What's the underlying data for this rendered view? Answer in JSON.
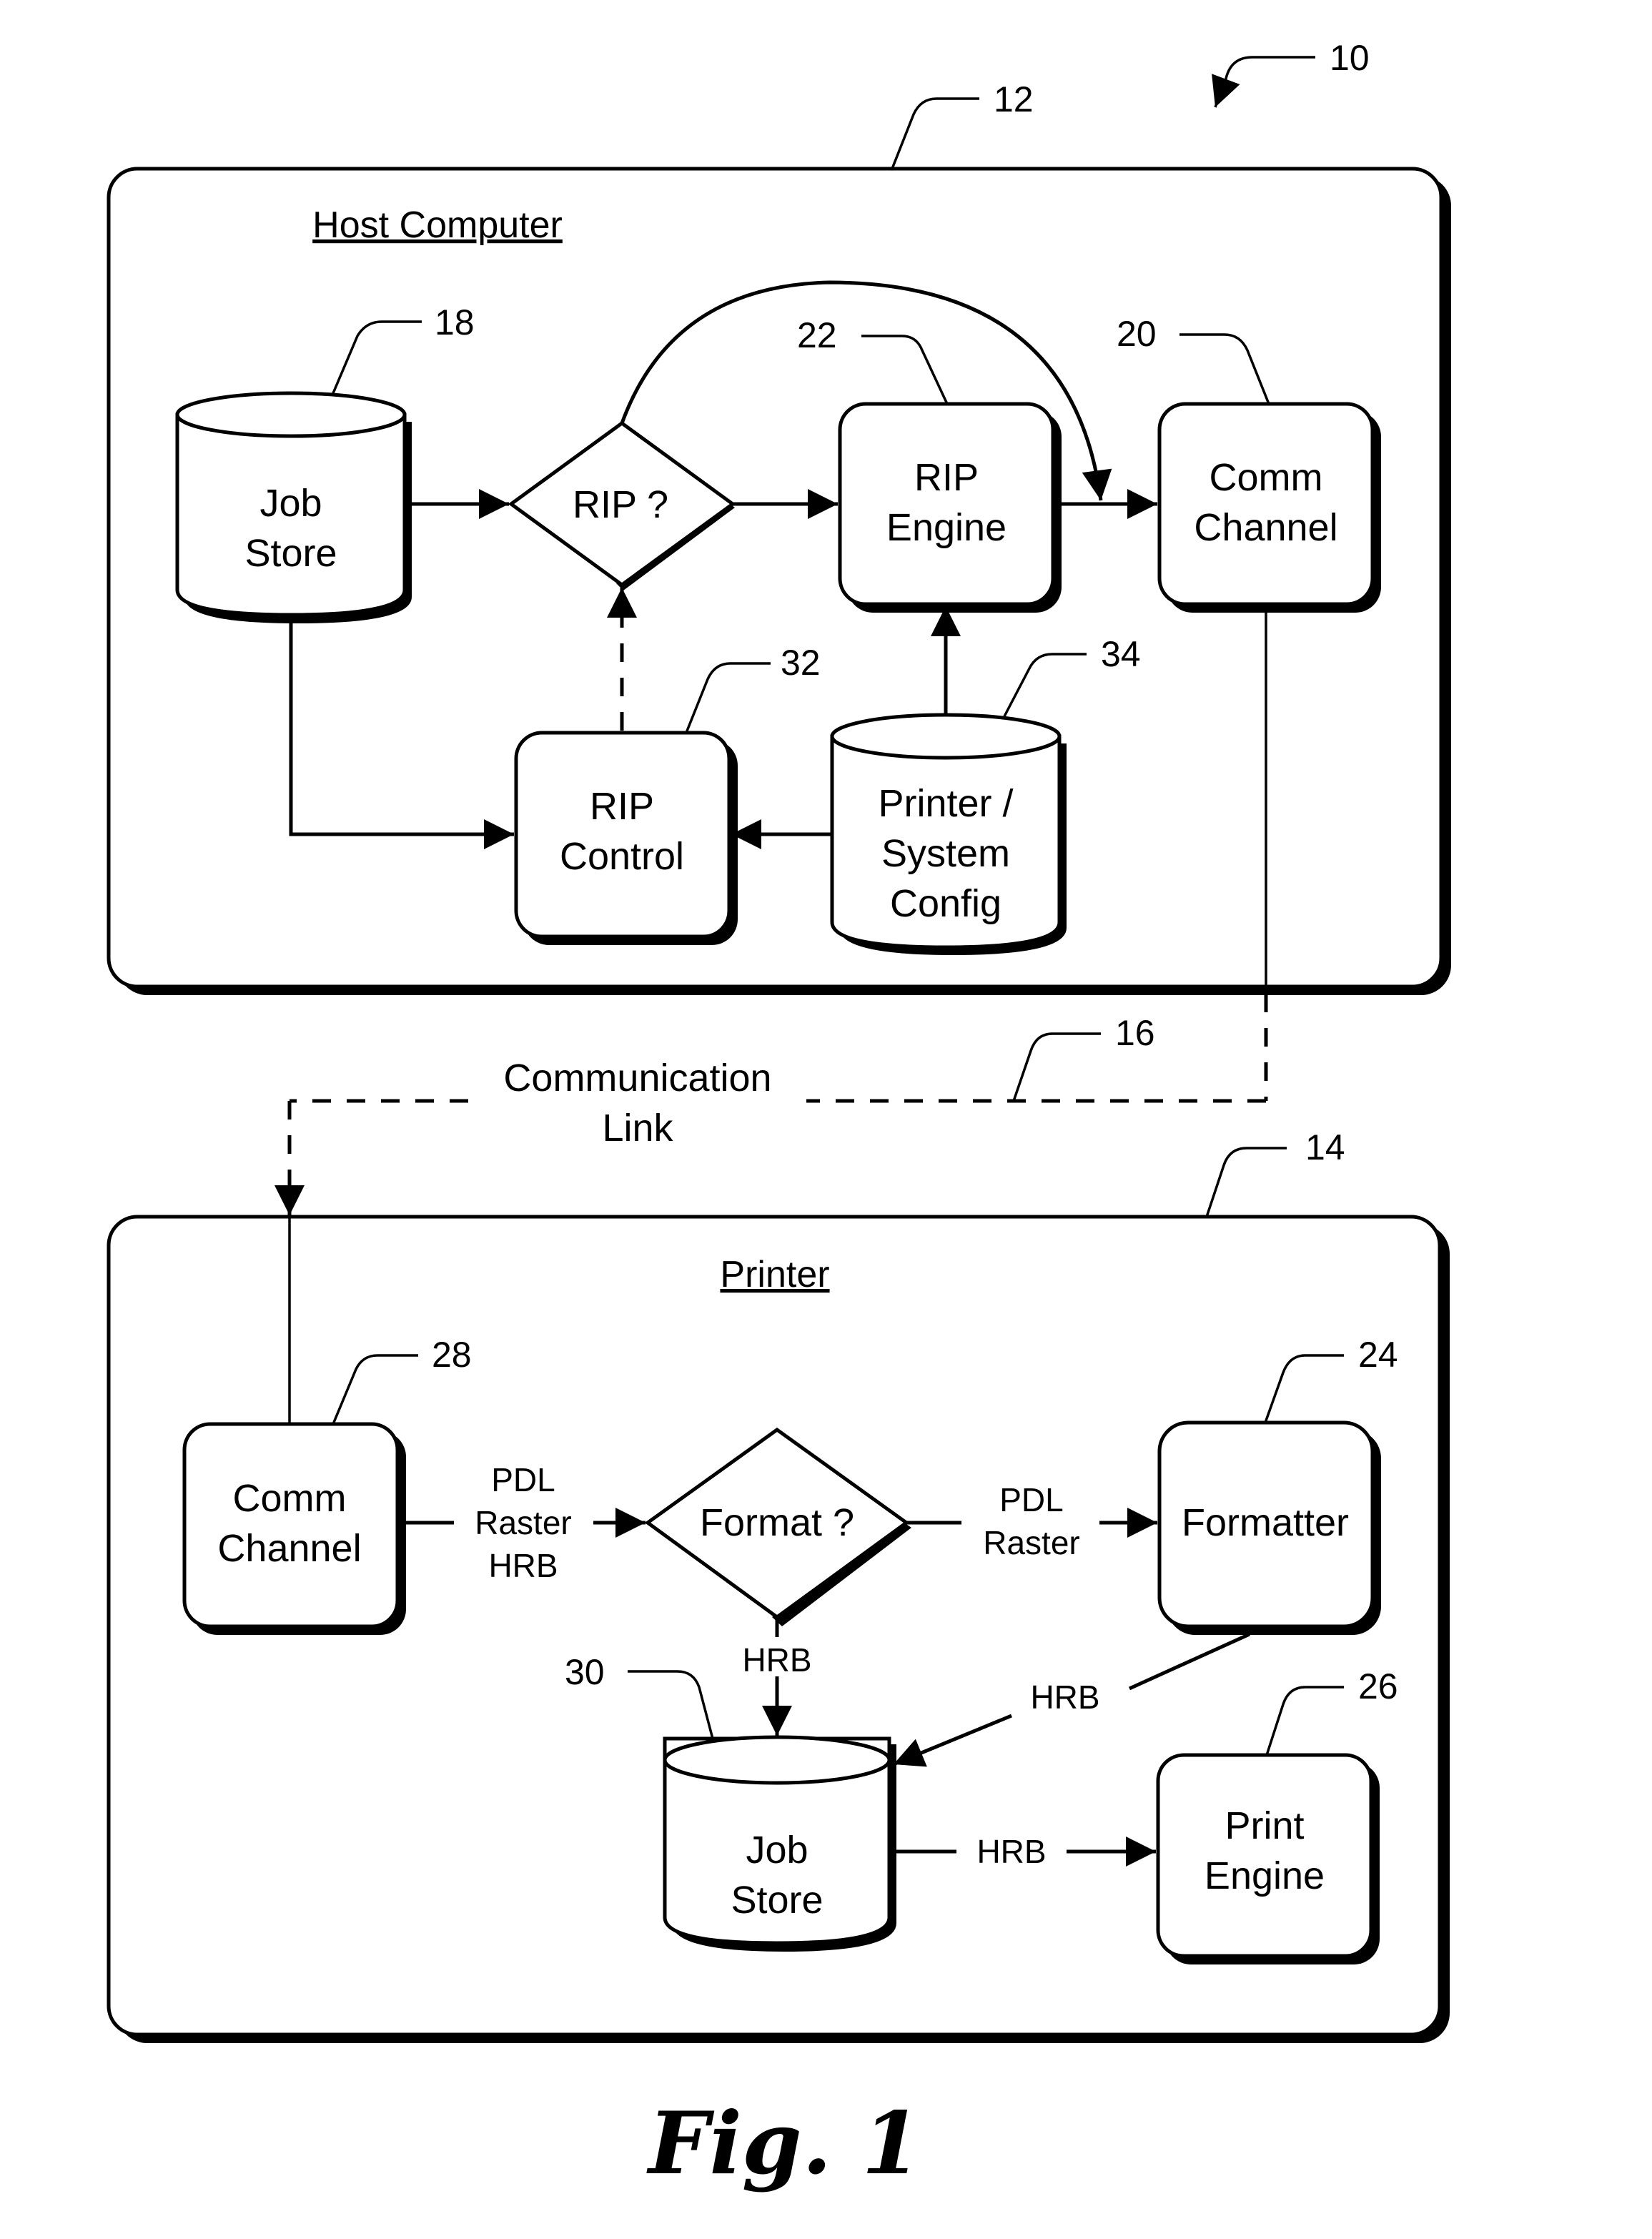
{
  "figure": {
    "caption": "Fig. 1",
    "system_ref": "10"
  },
  "containers": {
    "host": {
      "title": "Host Computer",
      "ref": "12"
    },
    "printer": {
      "title": "Printer",
      "ref": "14"
    }
  },
  "link": {
    "label_line1": "Communication",
    "label_line2": "Link",
    "ref": "16"
  },
  "host_nodes": {
    "job_store": {
      "lines": [
        "Job",
        "Store"
      ],
      "ref": "18",
      "shape": "cylinder"
    },
    "rip_decision": {
      "lines": [
        "RIP ?"
      ],
      "shape": "diamond"
    },
    "rip_engine": {
      "lines": [
        "RIP",
        "Engine"
      ],
      "ref": "22",
      "shape": "rounded-box"
    },
    "comm_channel": {
      "lines": [
        "Comm",
        "Channel"
      ],
      "ref": "20",
      "shape": "rounded-box"
    },
    "rip_control": {
      "lines": [
        "RIP",
        "Control"
      ],
      "ref": "32",
      "shape": "rounded-box"
    },
    "config": {
      "lines": [
        "Printer /",
        "System",
        "Config"
      ],
      "ref": "34",
      "shape": "cylinder"
    }
  },
  "printer_nodes": {
    "comm_channel": {
      "lines": [
        "Comm",
        "Channel"
      ],
      "ref": "28",
      "shape": "rounded-box"
    },
    "format_decision": {
      "lines": [
        "Format ?"
      ],
      "shape": "diamond"
    },
    "formatter": {
      "lines": [
        "Formatter"
      ],
      "ref": "24",
      "shape": "rounded-box"
    },
    "job_store": {
      "lines": [
        "Job",
        "Store"
      ],
      "ref": "30",
      "shape": "cylinder"
    },
    "print_engine": {
      "lines": [
        "Print",
        "Engine"
      ],
      "ref": "26",
      "shape": "rounded-box"
    }
  },
  "edge_labels": {
    "comm_to_format": [
      "PDL",
      "Raster",
      "HRB"
    ],
    "format_to_formatter": [
      "PDL",
      "Raster"
    ],
    "format_to_store": "HRB",
    "formatter_to_store": "HRB",
    "store_to_engine": "HRB"
  },
  "edges": [
    {
      "from": "Job Store (18)",
      "to": "RIP ?",
      "style": "solid"
    },
    {
      "from": "RIP ?",
      "to": "RIP Engine",
      "style": "solid"
    },
    {
      "from": "RIP ?",
      "to": "Comm Channel (20)",
      "style": "solid-arc"
    },
    {
      "from": "RIP Engine",
      "to": "Comm Channel (20)",
      "style": "solid"
    },
    {
      "from": "Job Store (18)",
      "to": "RIP Control",
      "style": "solid"
    },
    {
      "from": "RIP Control",
      "to": "RIP ?",
      "style": "dashed"
    },
    {
      "from": "Printer / System Config",
      "to": "RIP Control",
      "style": "solid"
    },
    {
      "from": "Printer / System Config",
      "to": "RIP Engine",
      "style": "solid"
    },
    {
      "from": "Comm Channel (20)",
      "to": "Comm Channel (28)",
      "style": "dashed",
      "label": "Communication Link"
    },
    {
      "from": "Comm Channel (28)",
      "to": "Format ?",
      "style": "solid",
      "label": "PDL Raster HRB"
    },
    {
      "from": "Format ?",
      "to": "Formatter",
      "style": "solid",
      "label": "PDL Raster"
    },
    {
      "from": "Format ?",
      "to": "Job Store (30)",
      "style": "solid",
      "label": "HRB"
    },
    {
      "from": "Formatter",
      "to": "Job Store (30)",
      "style": "solid",
      "label": "HRB"
    },
    {
      "from": "Job Store (30)",
      "to": "Print Engine",
      "style": "solid",
      "label": "HRB"
    }
  ]
}
